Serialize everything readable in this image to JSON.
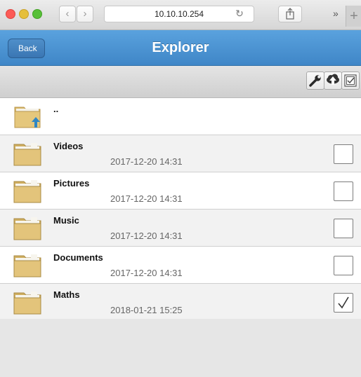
{
  "browser": {
    "url": "10.10.10.254"
  },
  "app": {
    "back_label": "Back",
    "title": "Explorer"
  },
  "toolbar": {
    "icons": [
      "wrench-icon",
      "cloud-upload-icon",
      "select-all-icon"
    ]
  },
  "list": {
    "parent": {
      "name": ".."
    },
    "items": [
      {
        "name": "Videos",
        "date": "2017-12-20 14:31",
        "checked": false
      },
      {
        "name": "Pictures",
        "date": "2017-12-20 14:31",
        "checked": false
      },
      {
        "name": "Music",
        "date": "2017-12-20 14:31",
        "checked": false
      },
      {
        "name": "Documents",
        "date": "2017-12-20 14:31",
        "checked": false
      },
      {
        "name": "Maths",
        "date": "2018-01-21 15:25",
        "checked": true
      }
    ]
  },
  "colors": {
    "header": "#4b93d3",
    "folder": "#e1c27a",
    "upload_arrow": "#2f86c4"
  }
}
